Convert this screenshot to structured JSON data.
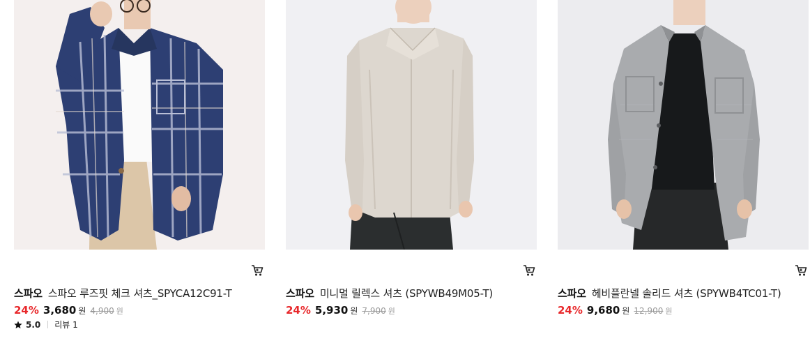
{
  "products": [
    {
      "brand": "스파오",
      "name": "스파오 루즈핏 체크 셔츠_SPYCA12C91-T",
      "discount": "24%",
      "price": "3,680",
      "price_unit": "원",
      "original_price": "4,900",
      "original_unit": "원",
      "rating": "5.0",
      "review_label": "리뷰 1",
      "photo_alt": "model wearing navy plaid loose-fit shirt"
    },
    {
      "brand": "스파오",
      "name": "미니멀 릴렉스 셔츠 (SPYWB49M05-T)",
      "discount": "24%",
      "price": "5,930",
      "price_unit": "원",
      "original_price": "7,900",
      "original_unit": "원",
      "photo_alt": "model wearing beige minimal relax shirt"
    },
    {
      "brand": "스파오",
      "name": "헤비플란넬 솔리드 셔츠 (SPYWB4TC01-T)",
      "discount": "24%",
      "price": "9,680",
      "price_unit": "원",
      "original_price": "12,900",
      "original_unit": "원",
      "photo_alt": "model wearing grey heavy flannel shirt"
    }
  ],
  "icons": {
    "cart": "cart-icon",
    "star": "star-icon"
  },
  "colors": {
    "discount": "#e8282b",
    "price": "#111111",
    "original_price": "#9a9a9a"
  }
}
